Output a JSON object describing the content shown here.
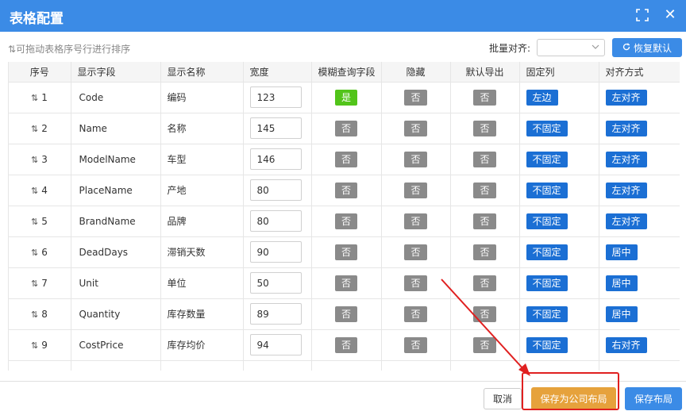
{
  "dialog": {
    "title": "表格配置"
  },
  "toolbar": {
    "hint": "可拖动表格序号行进行排序",
    "batch_align_label": "批量对齐:",
    "batch_align_value": "",
    "restore_label": "恢复默认"
  },
  "table": {
    "headers": [
      "序号",
      "显示字段",
      "显示名称",
      "宽度",
      "模糊查询字段",
      "隐藏",
      "默认导出",
      "固定列",
      "对齐方式"
    ],
    "rows": [
      {
        "seq": "1",
        "field": "Code",
        "name": "编码",
        "width": "123",
        "fuzzy": "是",
        "hidden": "否",
        "export": "否",
        "fixed": "左边",
        "align": "左对齐"
      },
      {
        "seq": "2",
        "field": "Name",
        "name": "名称",
        "width": "145",
        "fuzzy": "否",
        "hidden": "否",
        "export": "否",
        "fixed": "不固定",
        "align": "左对齐"
      },
      {
        "seq": "3",
        "field": "ModelName",
        "name": "车型",
        "width": "146",
        "fuzzy": "否",
        "hidden": "否",
        "export": "否",
        "fixed": "不固定",
        "align": "左对齐"
      },
      {
        "seq": "4",
        "field": "PlaceName",
        "name": "产地",
        "width": "80",
        "fuzzy": "否",
        "hidden": "否",
        "export": "否",
        "fixed": "不固定",
        "align": "左对齐"
      },
      {
        "seq": "5",
        "field": "BrandName",
        "name": "品牌",
        "width": "80",
        "fuzzy": "否",
        "hidden": "否",
        "export": "否",
        "fixed": "不固定",
        "align": "左对齐"
      },
      {
        "seq": "6",
        "field": "DeadDays",
        "name": "滞销天数",
        "width": "90",
        "fuzzy": "否",
        "hidden": "否",
        "export": "否",
        "fixed": "不固定",
        "align": "居中"
      },
      {
        "seq": "7",
        "field": "Unit",
        "name": "单位",
        "width": "50",
        "fuzzy": "否",
        "hidden": "否",
        "export": "否",
        "fixed": "不固定",
        "align": "居中"
      },
      {
        "seq": "8",
        "field": "Quantity",
        "name": "库存数量",
        "width": "89",
        "fuzzy": "否",
        "hidden": "否",
        "export": "否",
        "fixed": "不固定",
        "align": "居中"
      },
      {
        "seq": "9",
        "field": "CostPrice",
        "name": "库存均价",
        "width": "94",
        "fuzzy": "否",
        "hidden": "否",
        "export": "否",
        "fixed": "不固定",
        "align": "右对齐"
      }
    ]
  },
  "footer": {
    "cancel_label": "取消",
    "save_company_label": "保存为公司布局",
    "save_label": "保存布局"
  },
  "colors": {
    "primary": "#3b8be6",
    "warning": "#e6a23c",
    "success": "#52c41a",
    "neutral": "#8a8a8a",
    "annotation": "#e02020"
  },
  "icons": [
    "expand-icon",
    "close-icon",
    "sort-icon",
    "chevron-down-icon",
    "refresh-icon",
    "drag-handle-icon"
  ]
}
